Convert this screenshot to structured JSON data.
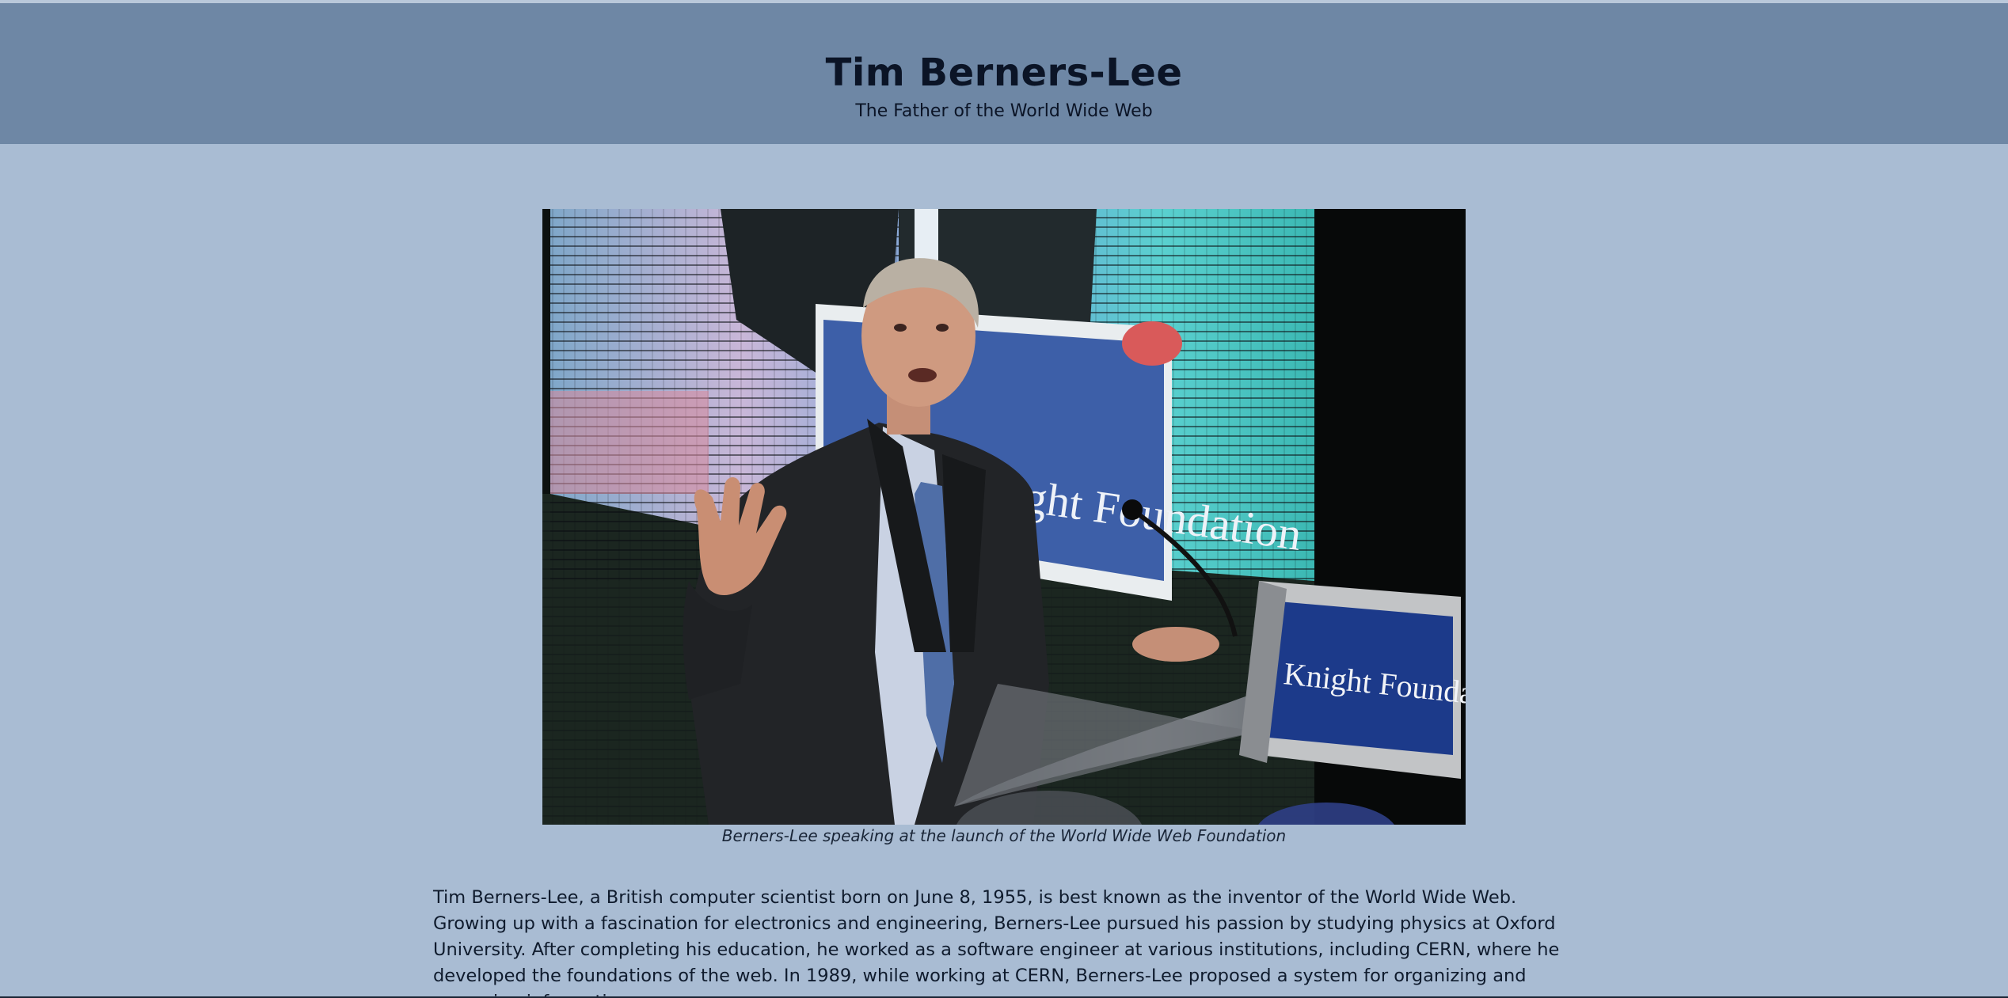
{
  "header": {
    "title": "Tim Berners-Lee",
    "subtitle": "The Father of the World Wide Web"
  },
  "figure": {
    "image_alt": "Tim Berners-Lee speaking at a podium in front of a large screen",
    "podium_text": "Knight Foundation",
    "screen_text": "Knight Foundation",
    "caption": "Berners-Lee speaking at the launch of the World Wide Web Foundation"
  },
  "bio": {
    "paragraph": "Tim Berners-Lee, a British computer scientist born on June 8, 1955, is best known as the inventor of the World Wide Web. Growing up with a fascination for electronics and engineering, Berners-Lee pursued his passion by studying physics at Oxford University. After completing his education, he worked as a software engineer at various institutions, including CERN, where he developed the foundations of the web. In 1989, while working at CERN, Berners-Lee proposed a system for organizing and accessing information over"
  },
  "colors": {
    "background": "#a9bcd3",
    "header_bg": "#6e87a5",
    "text": "#0f1b2d",
    "podium_panel": "#1c3a8a"
  }
}
